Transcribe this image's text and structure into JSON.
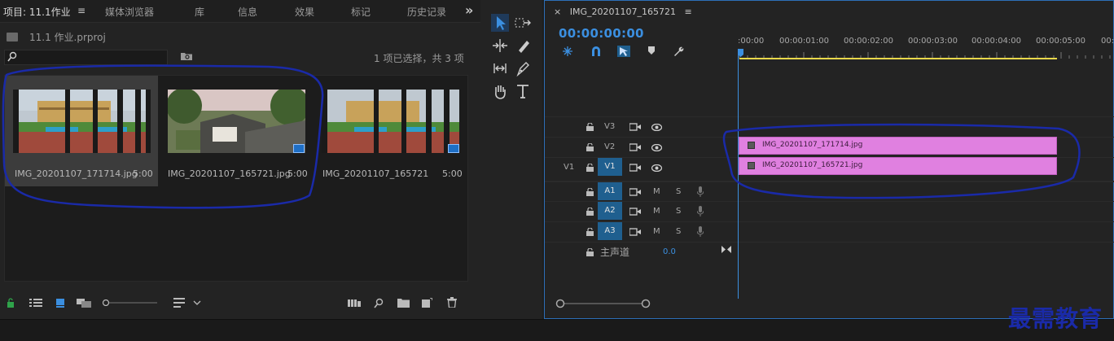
{
  "project_panel": {
    "tabs": [
      {
        "label": "项目: 11.1作业"
      },
      {
        "label": "媒体浏览器"
      },
      {
        "label": "库"
      },
      {
        "label": "信息"
      },
      {
        "label": "效果"
      },
      {
        "label": "标记"
      },
      {
        "label": "历史记录"
      }
    ],
    "tab_menu_glyph": "≡",
    "overflow_glyph": "»",
    "file_name": "11.1 作业.prproj",
    "selection_status": "1 项已选择，共 3 项",
    "clips": [
      {
        "name": "IMG_20201107_171714.jpg",
        "duration": "5:00",
        "selected": true
      },
      {
        "name": "IMG_20201107_165721.jpg",
        "duration": "5:00",
        "selected": false
      },
      {
        "name": "IMG_20201107_165721",
        "duration": "5:00",
        "selected": false
      }
    ]
  },
  "timeline": {
    "sequence_tab": "IMG_20201107_165721",
    "close_glyph": "×",
    "menu_glyph": "≡",
    "timecode": "00:00:00:00",
    "ruler_labels": [
      ":00:00",
      "00:00:01:00",
      "00:00:02:00",
      "00:00:03:00",
      "00:00:04:00",
      "00:00:05:00",
      "00:"
    ],
    "tracks": {
      "video": [
        {
          "name": "V3",
          "source": ""
        },
        {
          "name": "V2",
          "source": ""
        },
        {
          "name": "V1",
          "source": "V1"
        }
      ],
      "audio": [
        {
          "name": "A1",
          "m": "M",
          "s": "S"
        },
        {
          "name": "A2",
          "m": "M",
          "s": "S"
        },
        {
          "name": "A3",
          "m": "M",
          "s": "S"
        }
      ],
      "master_label": "主声道",
      "master_value": "0.0"
    },
    "clips": [
      {
        "track": "V2",
        "name": "IMG_20201107_171714.jpg"
      },
      {
        "track": "V1",
        "name": "IMG_20201107_165721.jpg"
      }
    ]
  },
  "watermark": "最需教育",
  "colors": {
    "accent": "#3b8fe0",
    "clip": "#e080e0",
    "annotation": "#1a2aa8"
  }
}
